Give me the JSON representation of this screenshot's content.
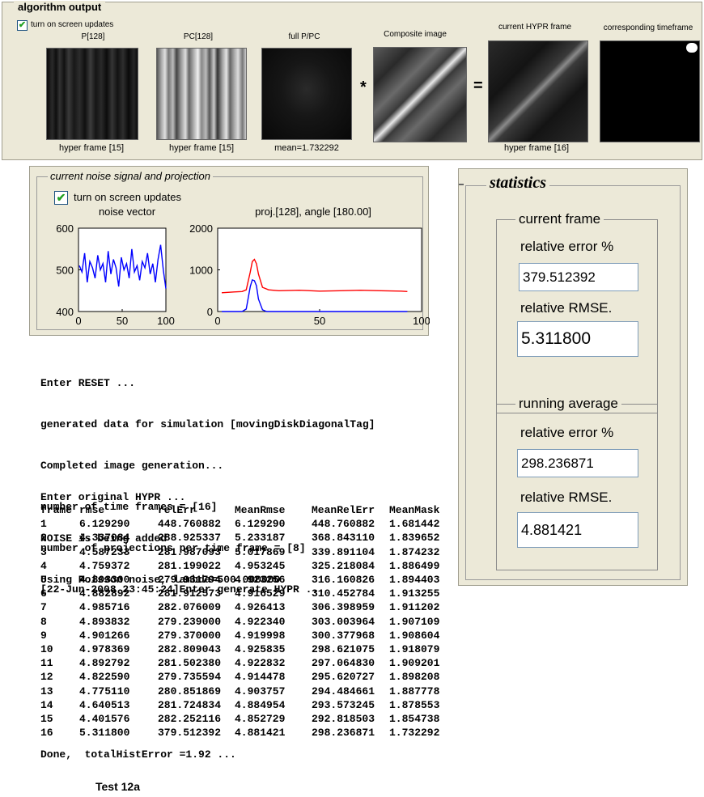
{
  "algorithm_output": {
    "title": "algorithm output",
    "checkbox_label": "turn on screen updates",
    "checkbox_checked": true,
    "panels": [
      {
        "title": "P[128]",
        "caption": "hyper frame [15]"
      },
      {
        "title": "PC[128]",
        "caption": "hyper frame [15]"
      },
      {
        "title": "full P/PC",
        "caption": "mean=1.732292"
      },
      {
        "title": "Composite image",
        "caption": ""
      },
      {
        "title": "current HYPR frame",
        "caption": "hyper frame [16]"
      },
      {
        "title": "corresponding timeframe",
        "caption": ""
      }
    ],
    "operator_multiply": "*",
    "operator_equals": "="
  },
  "noise_panel": {
    "title": "current noise signal and projection",
    "checkbox_label": "turn on screen updates",
    "checkbox_checked": true,
    "noise_chart_title": "noise vector",
    "proj_chart_title": "proj.[128], angle [180.00]"
  },
  "chart_data": [
    {
      "type": "line",
      "title": "noise vector",
      "xlim": [
        0,
        100
      ],
      "ylim": [
        400,
        600
      ],
      "xticks": [
        "0",
        "50",
        "100"
      ],
      "yticks": [
        "600",
        "500",
        "400"
      ],
      "series": [
        {
          "color": "#0000ff",
          "x": [
            1,
            4,
            7,
            10,
            13,
            16,
            19,
            22,
            25,
            28,
            31,
            34,
            37,
            40,
            43,
            46,
            49,
            52,
            55,
            58,
            61,
            64,
            67,
            70,
            73,
            76,
            79,
            82,
            85,
            88,
            91,
            94,
            97,
            100
          ],
          "values": [
            510,
            495,
            540,
            470,
            520,
            505,
            480,
            535,
            500,
            515,
            470,
            545,
            490,
            525,
            505,
            460,
            530,
            500,
            515,
            480,
            550,
            495,
            510,
            475,
            520,
            505,
            540,
            490,
            515,
            470,
            525,
            560,
            500,
            455
          ]
        }
      ]
    },
    {
      "type": "line",
      "title": "proj.[128], angle [180.00]",
      "xlim": [
        0,
        100
      ],
      "ylim": [
        0,
        2000
      ],
      "xticks": [
        "0",
        "50",
        "100"
      ],
      "yticks": [
        "2000",
        "1000",
        "0"
      ],
      "series": [
        {
          "color": "#ff0000",
          "x": [
            2,
            8,
            12,
            14,
            16,
            17,
            18,
            19,
            20,
            22,
            25,
            30,
            40,
            50,
            60,
            70,
            80,
            90,
            93
          ],
          "values": [
            450,
            470,
            480,
            520,
            950,
            1200,
            1250,
            1150,
            900,
            580,
            520,
            500,
            510,
            490,
            500,
            510,
            500,
            490,
            480
          ]
        },
        {
          "color": "#0000ff",
          "x": [
            2,
            12,
            14,
            16,
            17,
            18,
            19,
            20,
            22,
            24,
            30,
            40,
            50,
            60,
            70,
            80,
            93
          ],
          "values": [
            0,
            0,
            60,
            600,
            760,
            740,
            620,
            300,
            40,
            0,
            0,
            0,
            0,
            0,
            0,
            0,
            0
          ]
        }
      ]
    }
  ],
  "statistics": {
    "title": "statistics",
    "current_frame": {
      "title": "current frame",
      "rel_error_label": "relative error %",
      "rel_error_value": "379.512392",
      "rmse_label": "relative RMSE.",
      "rmse_value": "5.311800"
    },
    "running_average": {
      "title": "running average",
      "rel_error_label": "relative error %",
      "rel_error_value": "298.236871",
      "rmse_label": "relative RMSE.",
      "rmse_value": "4.881421"
    }
  },
  "console": {
    "lines_top": [
      "Enter RESET ...",
      "generated data for simulation [movingDiskDiagonalTag]",
      "Completed image generation...",
      "number of time frames = [16]",
      "number of projections per time frame = [8]",
      "[22-Jun-2008 23:45:24]Enter generate HYPR ..."
    ],
    "lines_mid": [
      "Enter original HYPR ...",
      "NOISE is being added",
      "Using Poisson noise, lambda=500.000000"
    ],
    "table_headers": [
      "frame",
      "rmse",
      "relErr",
      "MeanRmse",
      "MeanRelErr",
      "MeanMask"
    ],
    "table_rows": [
      [
        "1",
        "6.129290",
        "448.760882",
        "6.129290",
        "448.760882",
        "1.681442"
      ],
      [
        "2",
        "4.337084",
        "288.925337",
        "5.233187",
        "368.843110",
        "1.839652"
      ],
      [
        "3",
        "4.587233",
        "281.987093",
        "5.017869",
        "339.891104",
        "1.874232"
      ],
      [
        "4",
        "4.759372",
        "281.199022",
        "4.953245",
        "325.218084",
        "1.886499"
      ],
      [
        "5",
        "4.803300",
        "279.931794",
        "4.923256",
        "316.160826",
        "1.894403"
      ],
      [
        "6",
        "4.882892",
        "281.912573",
        "4.916529",
        "310.452784",
        "1.913255"
      ],
      [
        "7",
        "4.985716",
        "282.076009",
        "4.926413",
        "306.398959",
        "1.911202"
      ],
      [
        "8",
        "4.893832",
        "279.239000",
        "4.922340",
        "303.003964",
        "1.907109"
      ],
      [
        "9",
        "4.901266",
        "279.370000",
        "4.919998",
        "300.377968",
        "1.908604"
      ],
      [
        "10",
        "4.978369",
        "282.809043",
        "4.925835",
        "298.621075",
        "1.918079"
      ],
      [
        "11",
        "4.892792",
        "281.502380",
        "4.922832",
        "297.064830",
        "1.909201"
      ],
      [
        "12",
        "4.822590",
        "279.735594",
        "4.914478",
        "295.620727",
        "1.898208"
      ],
      [
        "13",
        "4.775110",
        "280.851869",
        "4.903757",
        "294.484661",
        "1.887778"
      ],
      [
        "14",
        "4.640513",
        "281.724834",
        "4.884954",
        "293.573245",
        "1.878553"
      ],
      [
        "15",
        "4.401576",
        "282.252116",
        "4.852729",
        "292.818503",
        "1.854738"
      ],
      [
        "16",
        "5.311800",
        "379.512392",
        "4.881421",
        "298.236871",
        "1.732292"
      ]
    ],
    "done_line": "Done,  totalHistError =1.92 ..."
  },
  "footer_label": "Test 12a"
}
